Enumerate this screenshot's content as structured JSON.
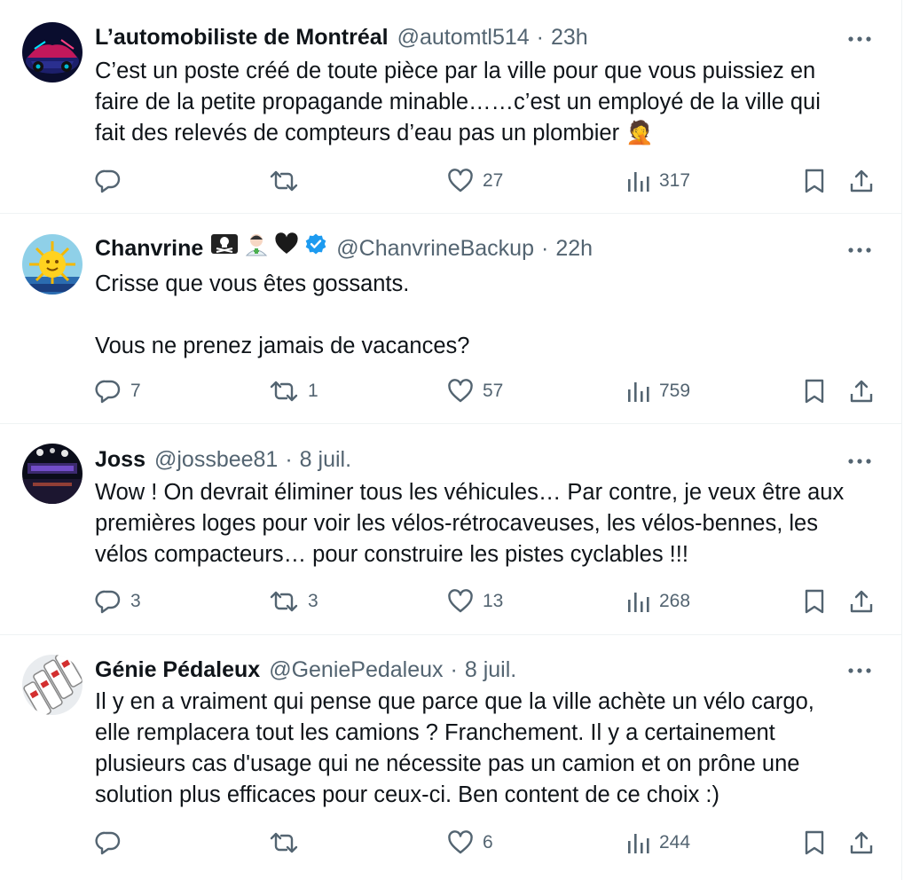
{
  "tweets": [
    {
      "name": "L’automobiliste de Montréal",
      "handle": "@automtl514",
      "sep": "·",
      "time": "23h",
      "text": "C’est un poste créé de toute pièce par la ville pour que vous puissiez en\nfaire de la petite propagande minable……c’est un employé de la ville qui\nfait des relevés de compteurs d’eau pas un plombier 🤦",
      "replies": "",
      "retweets": "",
      "likes": "27",
      "views": "317"
    },
    {
      "name": "Chanvrine",
      "name_emojis": "🏴‍☠️ 🧑‍⚕️ 🖤",
      "verified": true,
      "handle": "@ChanvrineBackup",
      "sep": "·",
      "time": "22h",
      "text": "Crisse que vous êtes gossants.\n\nVous ne prenez jamais de vacances?",
      "replies": "7",
      "retweets": "1",
      "likes": "57",
      "views": "759"
    },
    {
      "name": "Joss",
      "handle": "@jossbee81",
      "sep": "·",
      "time": "8 juil.",
      "text": "Wow !  On devrait éliminer tous les véhicules…  Par contre, je veux être aux\npremières loges pour voir les vélos-rétrocaveuses, les vélos-bennes, les\nvélos compacteurs… pour construire les pistes cyclables !!!",
      "replies": "3",
      "retweets": "3",
      "likes": "13",
      "views": "268"
    },
    {
      "name": "Génie Pédaleux",
      "handle": "@GeniePedaleux",
      "sep": "·",
      "time": "8 juil.",
      "text": "Il y en a vraiment qui pense que parce que la ville achète un vélo cargo,\nelle remplacera tout les camions ? Franchement. Il y a certainement\nplusieurs cas d'usage qui ne nécessite pas un camion et on prône une\nsolution plus efficaces pour ceux-ci. Ben content de ce choix :)",
      "replies": "",
      "retweets": "",
      "likes": "6",
      "views": "244"
    }
  ],
  "icons": {
    "reply": "reply-icon",
    "retweet": "retweet-icon",
    "like": "heart-icon",
    "views": "views-icon",
    "bookmark": "bookmark-icon",
    "share": "share-icon",
    "more": "more-icon",
    "verified": "verified-badge-icon"
  },
  "colors": {
    "text": "#0f1419",
    "secondary": "#536471",
    "verified": "#1d9bf0",
    "divider": "#eff3f4"
  }
}
